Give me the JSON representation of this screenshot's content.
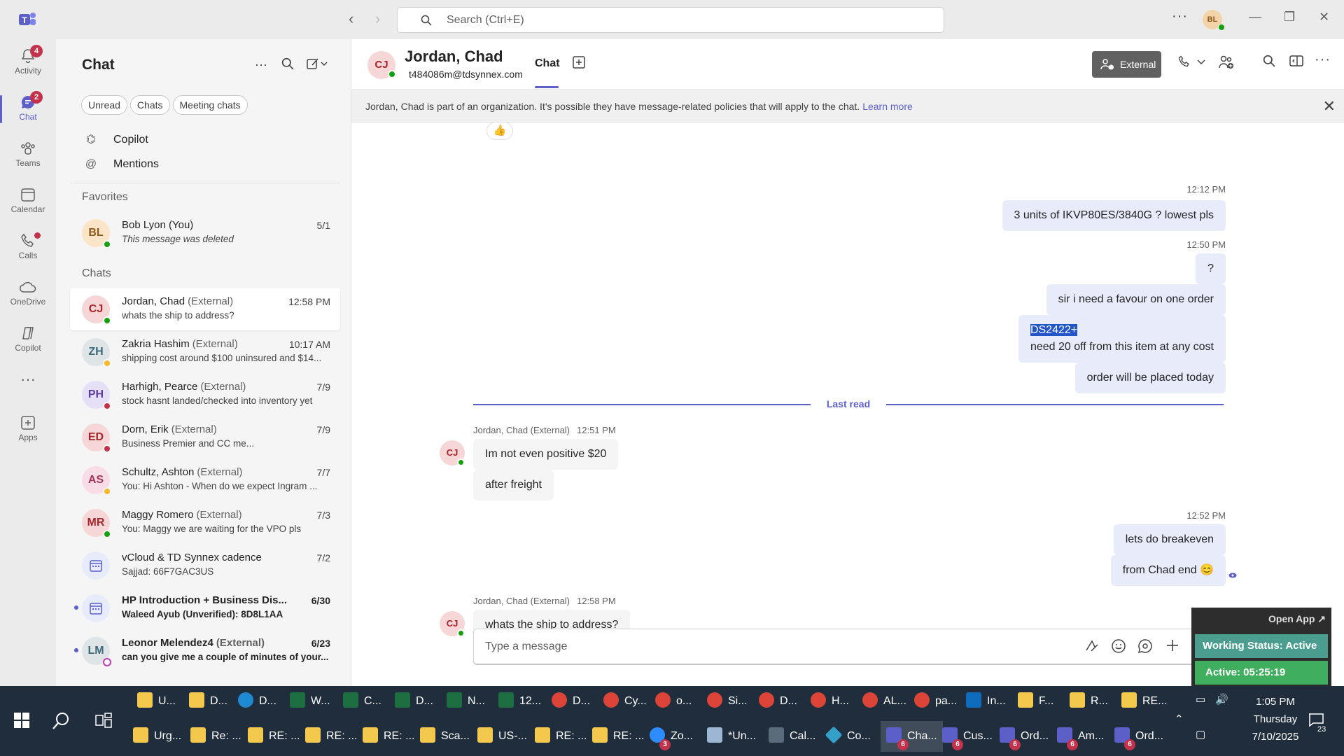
{
  "titlebar": {
    "search_placeholder": "Search (Ctrl+E)",
    "avatar_initials": "BL"
  },
  "rail": {
    "items": [
      {
        "label": "Activity",
        "badge": "4"
      },
      {
        "label": "Chat",
        "badge": "2"
      },
      {
        "label": "Teams"
      },
      {
        "label": "Calendar"
      },
      {
        "label": "Calls"
      },
      {
        "label": "OneDrive"
      },
      {
        "label": "Copilot"
      },
      {
        "label": "..."
      },
      {
        "label": "Apps"
      }
    ]
  },
  "chatlist": {
    "title": "Chat",
    "filters": [
      "Unread",
      "Chats",
      "Meeting chats"
    ],
    "links": [
      "Copilot",
      "Mentions"
    ],
    "favorites_header": "Favorites",
    "chats_header": "Chats",
    "favorites": [
      {
        "initials": "BL",
        "name": "Bob Lyon (You)",
        "ext": "",
        "date": "5/1",
        "preview": "This message was deleted"
      }
    ],
    "chats": [
      {
        "initials": "CJ",
        "name": "Jordan, Chad",
        "ext": "(External)",
        "date": "12:58 PM",
        "preview": "whats the ship to address?"
      },
      {
        "initials": "ZH",
        "name": "Zakria Hashim",
        "ext": "(External)",
        "date": "10:17 AM",
        "preview": "shipping cost around $100 uninsured and $14..."
      },
      {
        "initials": "PH",
        "name": "Harhigh, Pearce",
        "ext": "(External)",
        "date": "7/9",
        "preview": "stock hasnt landed/checked into inventory yet"
      },
      {
        "initials": "ED",
        "name": "Dorn, Erik",
        "ext": "(External)",
        "date": "7/9",
        "preview": "Business Premier and CC me..."
      },
      {
        "initials": "AS",
        "name": "Schultz, Ashton",
        "ext": "(External)",
        "date": "7/7",
        "preview": "You: Hi Ashton -  When do we expect Ingram ..."
      },
      {
        "initials": "MR",
        "name": "Maggy Romero",
        "ext": "(External)",
        "date": "7/3",
        "preview": "You: Maggy we are waiting for the VPO pls"
      },
      {
        "initials": "",
        "name": "vCloud & TD Synnex cadence",
        "ext": "",
        "date": "7/2",
        "preview": "Sajjad: 66F7GAC3US"
      },
      {
        "initials": "",
        "name": "HP Introduction + Business Dis...",
        "ext": "",
        "date": "6/30",
        "preview": "Waleed Ayub (Unverified): 8D8L1AA"
      },
      {
        "initials": "LM",
        "name": "Leonor Melendez4",
        "ext": "(External)",
        "date": "6/23",
        "preview": "can you give me a couple of minutes of your..."
      }
    ]
  },
  "header": {
    "initials": "CJ",
    "name": "Jordan, Chad",
    "email": "t484086m@tdsynnex.com",
    "tab": "Chat",
    "external_label": "External"
  },
  "banner": {
    "text": "Jordan, Chad is part of an organization. It's possible they have message-related policies that will apply to the chat.",
    "link": "Learn more"
  },
  "messages": {
    "t1": "12:12 PM",
    "m1": "3 units of IKVP80ES/3840G ? lowest pls",
    "t2": "12:50 PM",
    "m2": "?",
    "m3": "sir i need a favour on one order",
    "m4a": "DS2422+",
    "m4b": "need 20 off from this item at any cost",
    "m5": "order will be placed today",
    "last_read": "Last read",
    "in1_sender": "Jordan, Chad (External)",
    "in1_time": "12:51 PM",
    "in1a": "Im not even positive $20",
    "in1b": "after freight",
    "t3": "12:52 PM",
    "m6": "lets do breakeven",
    "m7": "from Chad end",
    "in2_sender": "Jordan, Chad (External)",
    "in2_time": "12:58 PM",
    "in2": "whats the ship to address?",
    "avatar": "CJ"
  },
  "composer": {
    "placeholder": "Type a message"
  },
  "widget": {
    "open_app": "Open App ↗",
    "status": "Working Status: Active",
    "active": "Active: 05:25:19"
  },
  "taskbar": {
    "row1": [
      "U...",
      "D...",
      "D...",
      "W...",
      "C...",
      "D...",
      "N...",
      "12...",
      "D...",
      "Cy...",
      "o...",
      "Si...",
      "D...",
      "H...",
      "AL...",
      "pa...",
      "In...",
      "F...",
      "R...",
      "RE..."
    ],
    "row2": [
      "Urg...",
      "Re: ...",
      "RE: ...",
      "RE: ...",
      "RE: ...",
      "Sca...",
      "US-...",
      "RE: ...",
      "RE: ...",
      "Zo...",
      "*Un...",
      "Cal...",
      "Co...",
      "Cha...",
      "Cus...",
      "Ord...",
      "Am...",
      "Ord..."
    ],
    "badges": {
      "zoom": "3",
      "teams": "6"
    },
    "time": "1:05 PM",
    "day": "Thursday",
    "date": "7/10/2025",
    "notif": "23"
  },
  "colors": {
    "accent": "#5b5fc7",
    "bubble_out": "#e8ebfa",
    "bubble_in": "#f5f5f5",
    "taskbar": "#1f2d3d"
  }
}
